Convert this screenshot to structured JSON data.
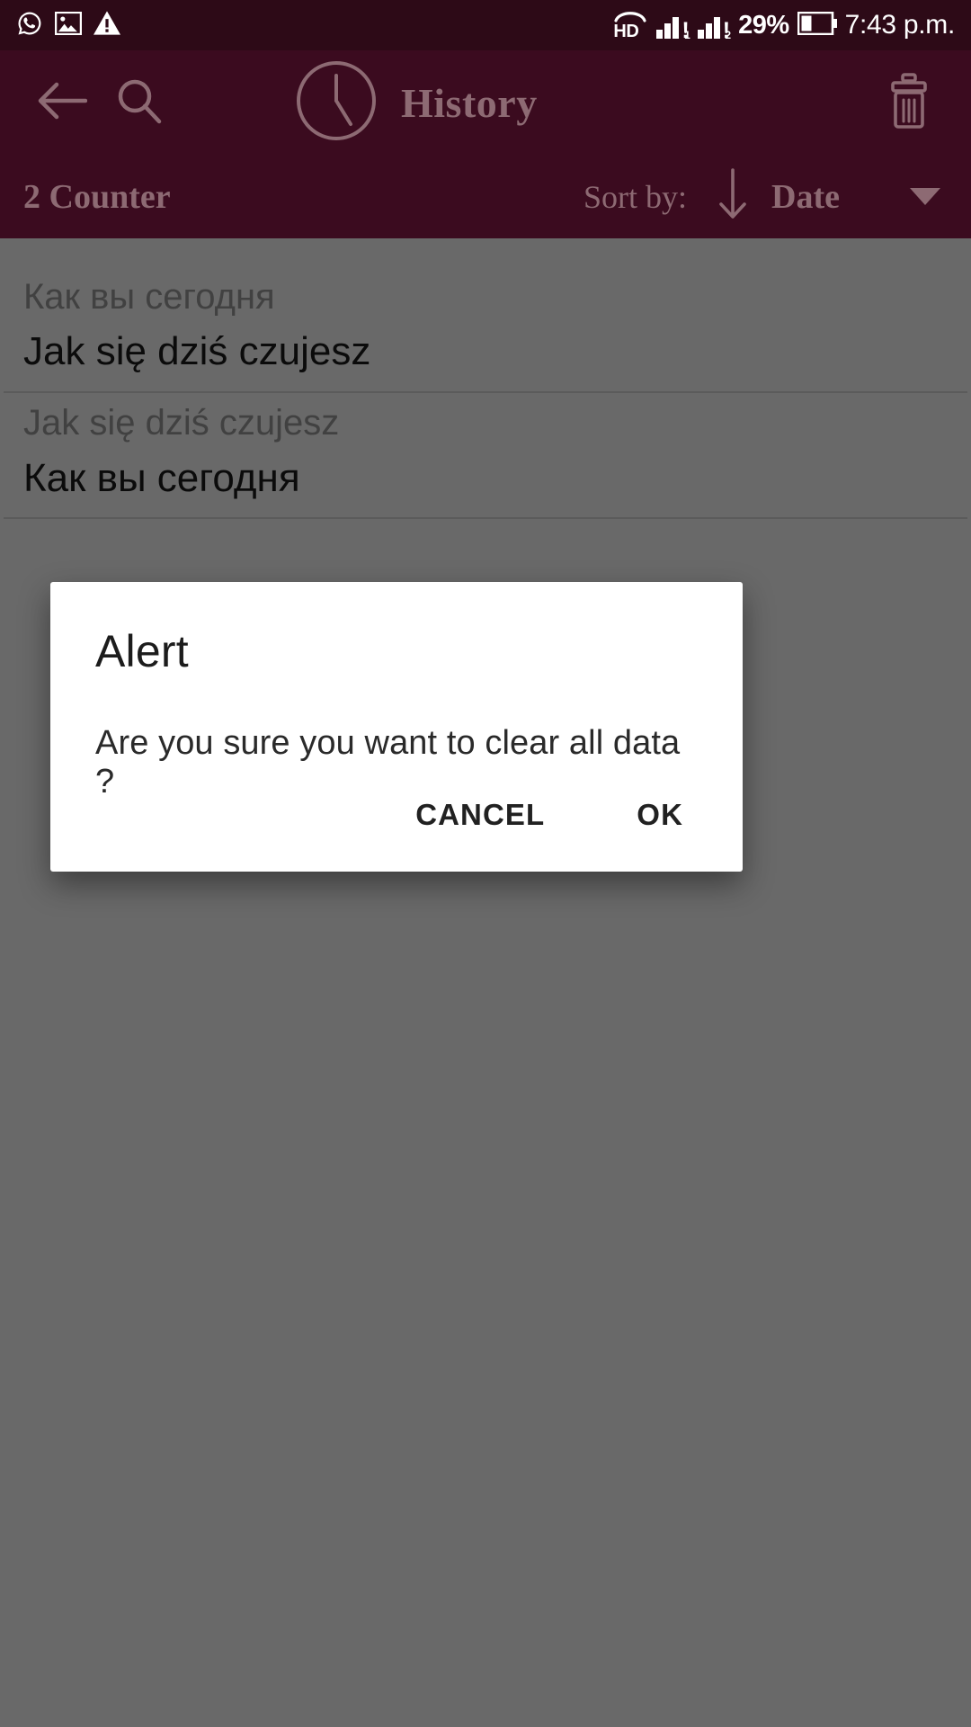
{
  "status_bar": {
    "left_icons": [
      "whatsapp-icon",
      "image-icon",
      "warning-icon"
    ],
    "network_type": "HD",
    "sim1_label": "1",
    "sim2_label": "2",
    "alert_mark": "!",
    "battery_percent": "29%",
    "time": "7:43 p.m.",
    "background_color": "#2d0a17",
    "icon_color": "#ffffff"
  },
  "app_bar": {
    "back_icon": "arrow-left-icon",
    "search_icon": "search-icon",
    "clock_icon": "clock-icon",
    "title": "History",
    "delete_icon": "trash-icon",
    "background_color": "#3b0b1f",
    "foreground_color": "#8d6a73"
  },
  "sort_bar": {
    "counter_label": "2 Counter",
    "sort_by_label": "Sort by:",
    "direction_icon": "arrow-down-icon",
    "sort_value": "Date",
    "dropdown_icon": "chevron-down-icon"
  },
  "history": {
    "items": [
      {
        "source": "Как вы сегодня",
        "translation": "Jak się dziś czujesz"
      },
      {
        "source": "Jak się dziś czujesz",
        "translation": "Как вы сегодня"
      }
    ]
  },
  "dialog": {
    "title": "Alert",
    "message": "Are you sure you want to clear all data ?",
    "cancel_label": "CANCEL",
    "ok_label": "OK"
  }
}
